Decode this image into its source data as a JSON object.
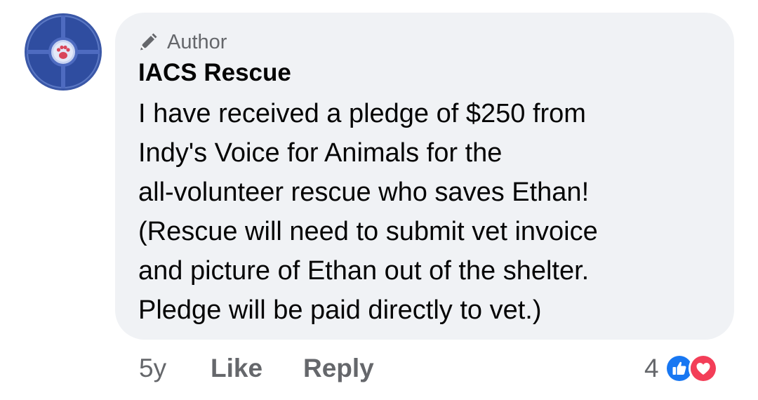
{
  "comment": {
    "author_badge": "Author",
    "author_name": "IACS Rescue",
    "text_lines": [
      "I have received a pledge of $250 from",
      "Indy's Voice for Animals for the",
      "all-volunteer rescue who saves Ethan!",
      "(Rescue will need to submit vet invoice",
      "and picture of Ethan out of the shelter.",
      "Pledge will be paid directly to vet.)"
    ],
    "avatar_icon": "paw-print-logo",
    "badge_icon": "pencil-icon"
  },
  "actions": {
    "time": "5y",
    "like_label": "Like",
    "reply_label": "Reply"
  },
  "reactions": {
    "count": "4",
    "icons": [
      "like-icon",
      "love-icon"
    ],
    "like_color": "#1877f2",
    "love_color": "#f33e58"
  },
  "colors": {
    "bubble_bg": "#f0f2f5",
    "secondary_text": "#65676b",
    "primary_text": "#050505"
  }
}
